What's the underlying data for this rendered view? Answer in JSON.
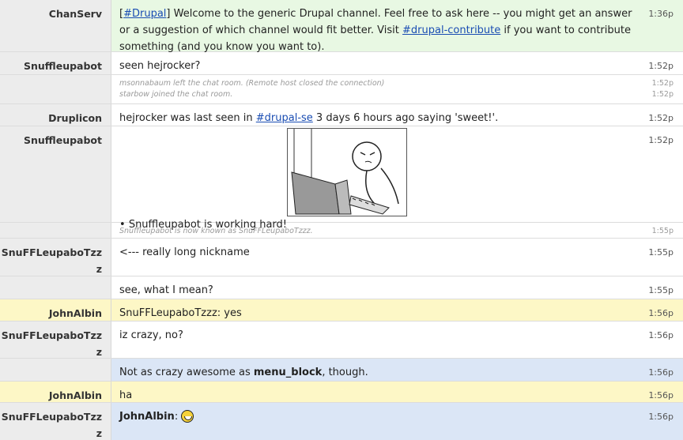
{
  "messages": [
    {
      "nick": "ChanServ",
      "time": "1:36p",
      "style": "green",
      "text_pre": "[",
      "link1": "#Drupal",
      "text_mid": "] Welcome to the generic Drupal channel. Feel free to ask here -- you might get an answer or a suggestion of which channel would fit better. Visit ",
      "link2": "#drupal-contribute",
      "text_post": " if you want to contribute something (and you know you want to)."
    },
    {
      "nick": "Snuffleupabot",
      "time": "1:52p",
      "text": "seen hejrocker?"
    },
    {
      "system": [
        {
          "text": "msonnabaum left the chat room. (Remote host closed the connection)",
          "time": "1:52p"
        },
        {
          "text": "starbow joined the chat room.",
          "time": "1:52p"
        }
      ]
    },
    {
      "nick": "Druplicon",
      "time": "1:52p",
      "text_pre": "hejrocker was last seen in ",
      "link": "#drupal-se",
      "text_post": " 3 days 6 hours ago saying 'sweet!'."
    },
    {
      "nick": "Snuffleupabot",
      "time": "1:52p",
      "bullet": "•",
      "text": "Snuffleupabot is working hard!",
      "image": "comic-drawing"
    },
    {
      "system_single": {
        "text": "Snuffleupabot is now known as SnuFFLeupaboTzzz.",
        "time": "1:55p"
      }
    },
    {
      "nick": "SnuFFLeupaboTzzz",
      "time": "1:55p",
      "text": "<--- really long nickname"
    },
    {
      "nick": "",
      "time": "1:55p",
      "text": "see, what I mean?"
    },
    {
      "nick": "JohnAlbin",
      "time": "1:56p",
      "style": "yellow",
      "text": "SnuFFLeupaboTzzz: yes"
    },
    {
      "nick": "SnuFFLeupaboTzzz",
      "time": "1:56p",
      "text": "iz crazy, no?"
    },
    {
      "nick": "",
      "time": "1:56p",
      "style": "blue",
      "text_pre": "Not as crazy awesome as ",
      "bold": "menu_block",
      "text_post": ", though."
    },
    {
      "nick": "JohnAlbin",
      "time": "1:56p",
      "style": "yellow",
      "text": "ha"
    },
    {
      "nick": "SnuFFLeupaboTzzz",
      "time": "1:56p",
      "style": "blue",
      "bold": "JohnAlbin",
      "text_post": ": ",
      "emoji": "grin-smiley-icon"
    }
  ]
}
